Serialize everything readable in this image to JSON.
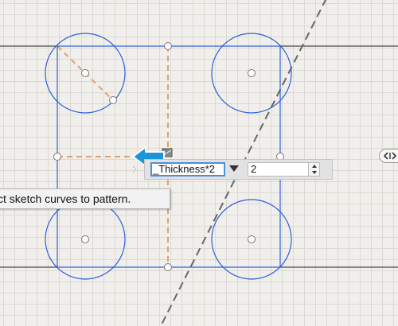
{
  "canvas": {
    "grid": true
  },
  "icons": {
    "direction_arrow": "left-arrow-icon",
    "side_handle": "double-chevron-icon"
  },
  "colors": {
    "sketch_curve": "#2e5fd6",
    "construction_line": "#e0a070",
    "pattern_axis": "#666666",
    "arrow": "#1a96d8",
    "field_focus": "#4a8fd9"
  },
  "input_bar": {
    "expression": "_Thickness*2",
    "quantity": "2"
  },
  "tooltip": {
    "text": "ct sketch curves to pattern."
  }
}
